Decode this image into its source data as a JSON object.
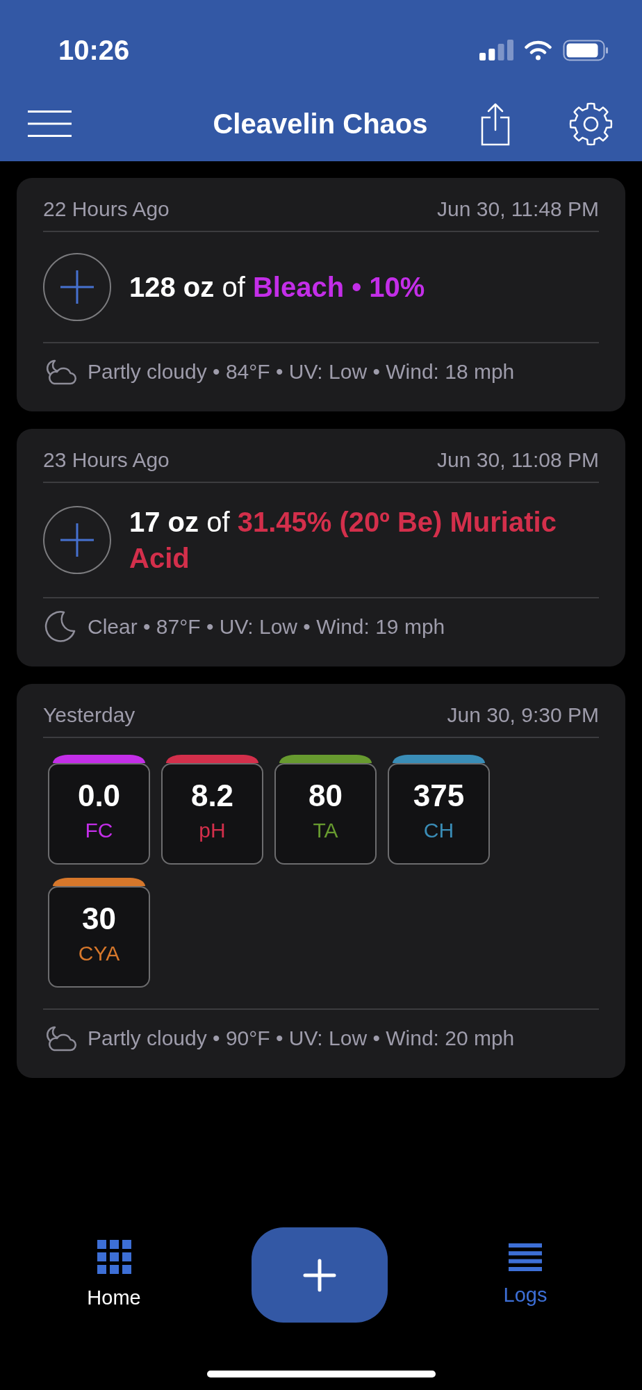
{
  "status_bar": {
    "time": "10:26"
  },
  "header": {
    "title": "Cleavelin Chaos"
  },
  "entries": [
    {
      "kind": "dose",
      "ago": "22 Hours Ago",
      "timestamp": "Jun 30, 11:48 PM",
      "amount": "128 oz",
      "joiner": "of",
      "product": "Bleach • 10%",
      "color": "#c32ee8",
      "weather": {
        "kind": "partly_cloudy_night",
        "text": "Partly cloudy • 84°F • UV: Low • Wind: 18 mph"
      }
    },
    {
      "kind": "dose",
      "ago": "23 Hours Ago",
      "timestamp": "Jun 30, 11:08 PM",
      "amount": "17 oz",
      "joiner": "of",
      "product": "31.45% (20º Be) Muriatic Acid",
      "color": "#d32f4b",
      "weather": {
        "kind": "clear_night",
        "text": "Clear • 87°F • UV: Low • Wind: 19 mph"
      }
    },
    {
      "kind": "test",
      "ago": "Yesterday",
      "timestamp": "Jun 30, 9:30 PM",
      "readings": [
        {
          "value": "0.0",
          "label": "FC",
          "color": "#c32ee8"
        },
        {
          "value": "8.2",
          "label": "pH",
          "color": "#d32f4b"
        },
        {
          "value": "80",
          "label": "TA",
          "color": "#679a2f"
        },
        {
          "value": "375",
          "label": "CH",
          "color": "#3a8db7"
        },
        {
          "value": "30",
          "label": "CYA",
          "color": "#d6772b"
        }
      ],
      "weather": {
        "kind": "partly_cloudy_night",
        "text": "Partly cloudy • 90°F • UV: Low • Wind: 20 mph"
      }
    }
  ],
  "tab_bar": {
    "tabs": [
      {
        "label": "Home",
        "selected": false
      },
      {
        "label": "Logs",
        "selected": true
      }
    ]
  }
}
